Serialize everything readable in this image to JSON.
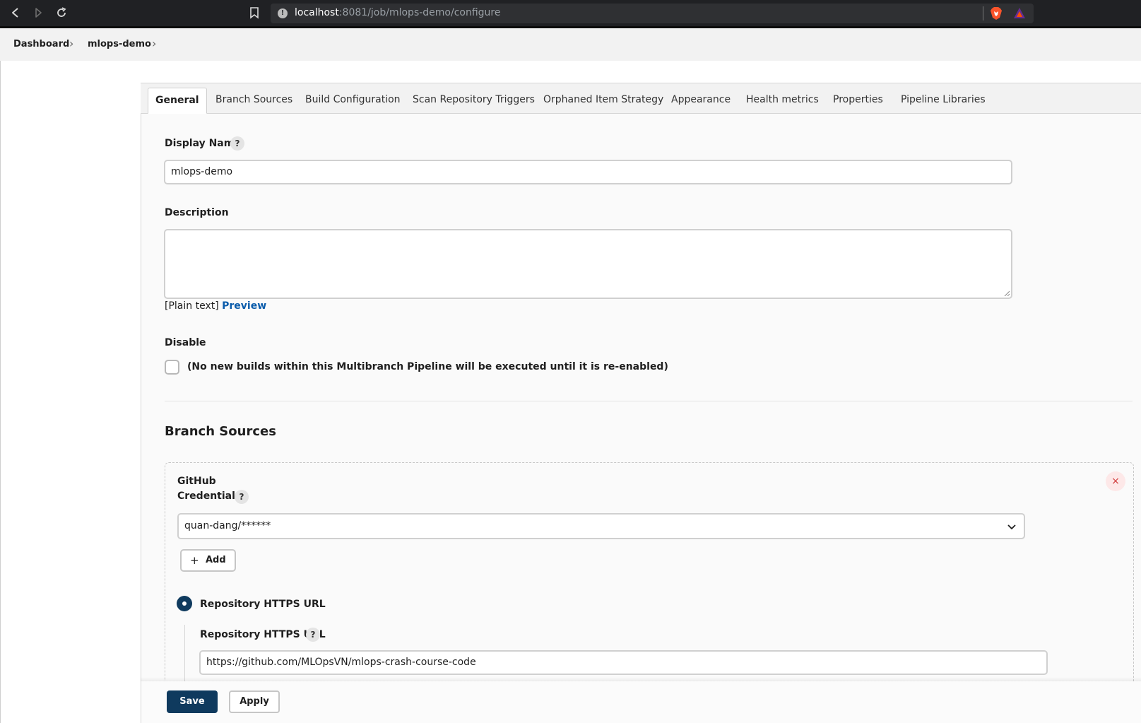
{
  "browser": {
    "url_host": "localhost",
    "url_path": ":8081/job/mlops-demo/configure"
  },
  "breadcrumb": {
    "items": [
      "Dashboard",
      "mlops-demo"
    ]
  },
  "tabs": [
    {
      "label": "General",
      "active": true
    },
    {
      "label": "Branch Sources"
    },
    {
      "label": "Build Configuration"
    },
    {
      "label": "Scan Repository Triggers"
    },
    {
      "label": "Orphaned Item Strategy"
    },
    {
      "label": "Appearance"
    },
    {
      "label": "Health metrics"
    },
    {
      "label": "Properties"
    },
    {
      "label": "Pipeline Libraries"
    }
  ],
  "general": {
    "display_name_label": "Display Name",
    "help_glyph": "?",
    "display_name_value": "mlops-demo",
    "description_label": "Description",
    "description_value": "",
    "plain_text": "[Plain text]",
    "preview_link": "Preview",
    "disable_label": "Disable",
    "disable_text": "(No new builds within this Multibranch Pipeline will be executed until it is re-enabled)",
    "disable_checked": false
  },
  "branch_sources": {
    "title": "Branch Sources",
    "source_type": "GitHub",
    "close_glyph": "×",
    "credentials_label": "Credentials",
    "credentials_value": "quan-dang/******",
    "add_plus": "+",
    "add_label": "Add",
    "radio_label": "Repository HTTPS URL",
    "repo_url_label": "Repository HTTPS URL",
    "repo_url_value": "https://github.com/MLOpsVN/mlops-crash-course-code"
  },
  "footer": {
    "save_label": "Save",
    "apply_label": "Apply"
  },
  "colors": {
    "primary": "#0f3a5e",
    "link": "#0b5cab",
    "danger": "#d13c3c"
  },
  "icons": [
    "back-icon",
    "forward-icon",
    "reload-icon",
    "bookmark-icon",
    "site-info-icon",
    "brave-shield-icon",
    "brave-rewards-icon",
    "chevron-right-icon",
    "help-icon",
    "close-icon",
    "chevron-down-icon",
    "plus-icon"
  ]
}
